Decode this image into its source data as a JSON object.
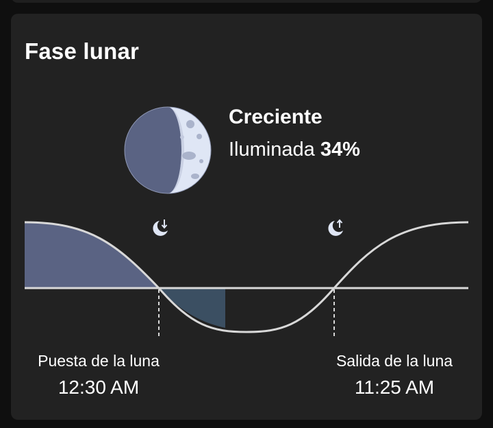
{
  "card": {
    "title": "Fase lunar"
  },
  "moon": {
    "phase_name": "Creciente",
    "illumination_label": "Iluminada",
    "illumination_value": "34%",
    "illumination_fraction": 0.34
  },
  "events": {
    "moonset": {
      "label": "Puesta de la luna",
      "time": "12:30 AM",
      "icon": "moonset-icon"
    },
    "moonrise": {
      "label": "Salida de la luna",
      "time": "11:25 AM",
      "icon": "moonrise-icon"
    }
  },
  "colors": {
    "background": "#0f0f0f",
    "card": "#222222",
    "moon_dark": "#5a6383",
    "moon_light": "#dfe6f5",
    "fill_above": "#5a6383",
    "fill_below": "#3b4f62",
    "curve": "#d8d8d8"
  }
}
